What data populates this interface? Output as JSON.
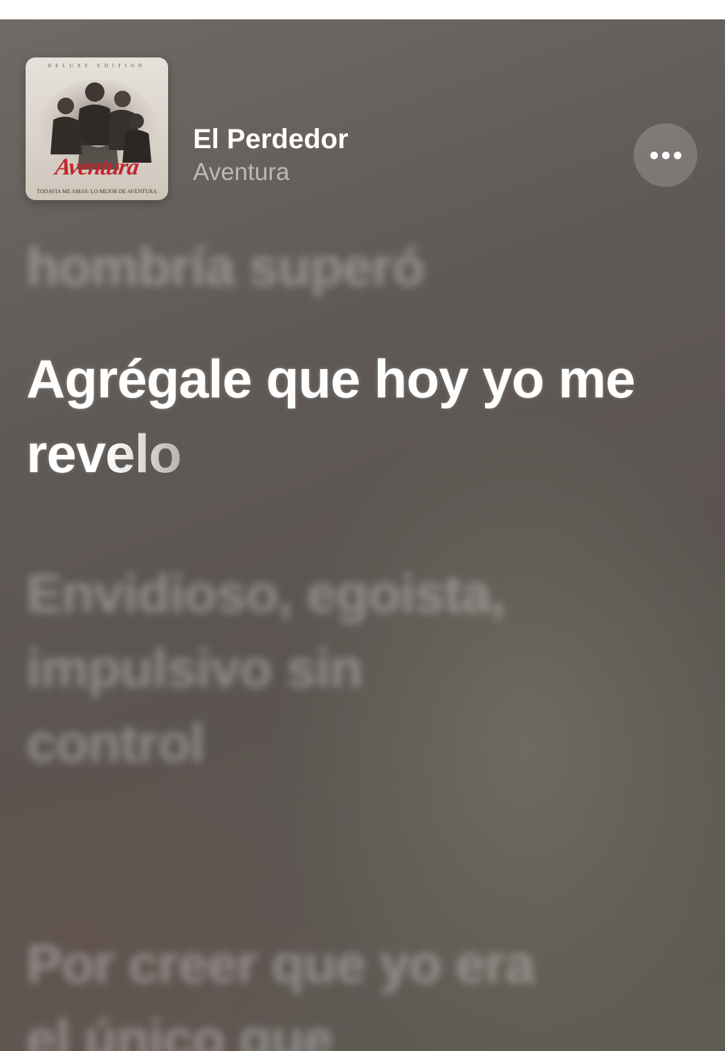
{
  "now_playing": {
    "title": "El Perdedor",
    "artist": "Aventura",
    "more_button_icon": "ellipsis-icon"
  },
  "album_art": {
    "edition_text": "DELUXE EDITION",
    "logo_text": "Aventura",
    "subtitle": "TODAVIA ME AMAS: LO MEJOR DE AVENTURA",
    "logo_color": "#c2262e"
  },
  "lyrics": {
    "previous": "hombría superó",
    "current_sung": "Agrégale que hoy yo me rev",
    "current_unsung": "elo",
    "next_1": "Envidioso, egoista, impulsivo sin control",
    "next_2": "Por creer que yo era el único que"
  }
}
